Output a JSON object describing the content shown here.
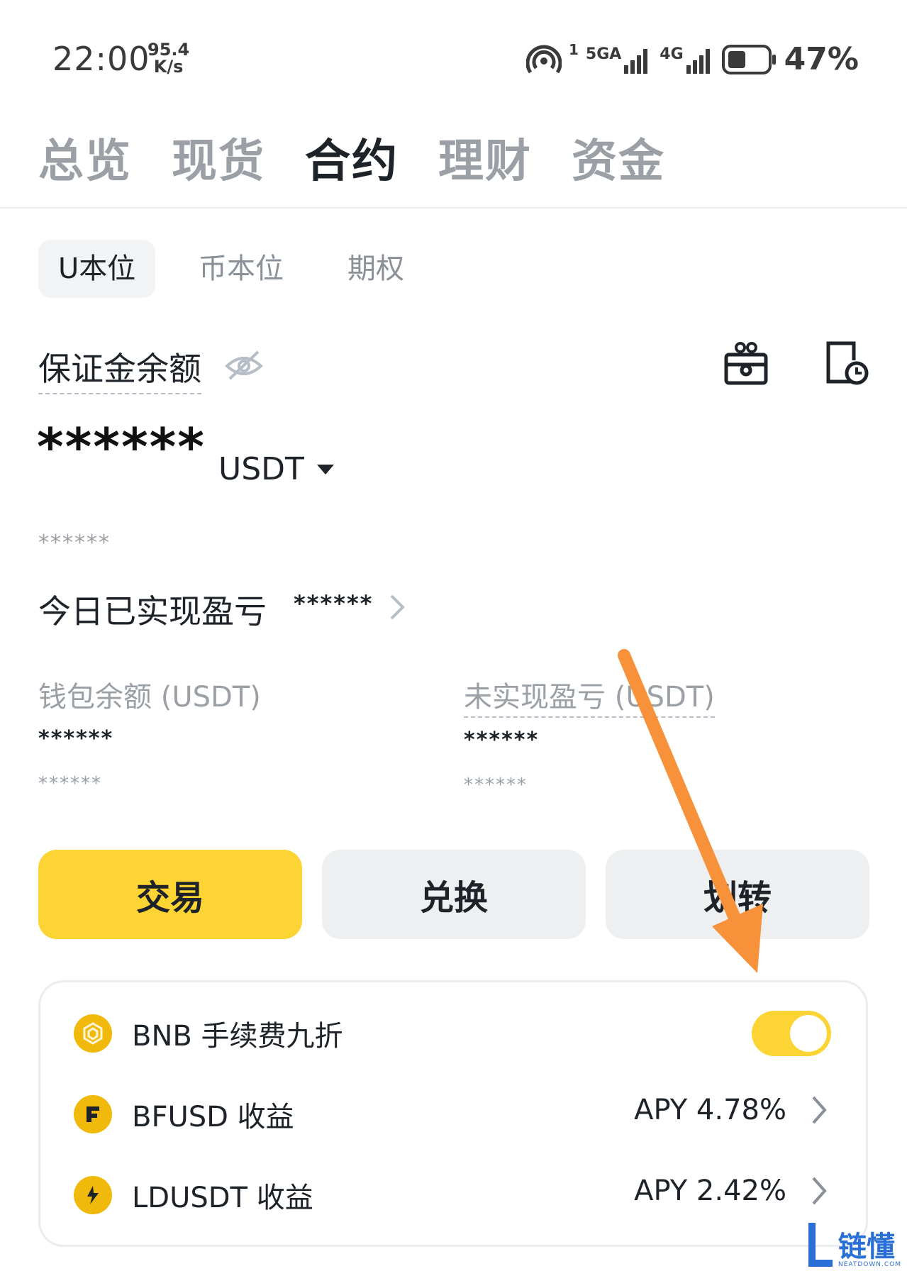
{
  "status_bar": {
    "time": "22:00",
    "speed_value": "95.4",
    "speed_unit": "K/s",
    "sim1_label": "1",
    "net1_label": "5GA",
    "net2_label": "4G",
    "battery_percent": "47%",
    "battery_level": 0.47
  },
  "top_tabs": [
    "总览",
    "现货",
    "合约",
    "理财",
    "资金"
  ],
  "top_tab_active": "合约",
  "sub_tabs": [
    "U本位",
    "币本位",
    "期权"
  ],
  "sub_tab_active": "U本位",
  "balance": {
    "label": "保证金余额",
    "amount": "******",
    "currency": "USDT",
    "equiv": "******"
  },
  "pnl": {
    "label": "今日已实现盈亏",
    "value": "******"
  },
  "wallet": {
    "label": "钱包余额 (USDT)",
    "value": "******",
    "sub": "******"
  },
  "unrealized": {
    "label": "未实现盈亏 (USDT)",
    "value": "******",
    "sub": "******"
  },
  "buttons": {
    "trade": "交易",
    "convert": "兑换",
    "transfer": "划转"
  },
  "features": [
    {
      "label": "BNB 手续费九折",
      "toggle_on": true
    },
    {
      "label": "BFUSD 收益",
      "apy": "APY 4.78%"
    },
    {
      "label": "LDUSDT 收益",
      "apy": "APY 2.42%"
    }
  ],
  "watermark": {
    "text": "链懂",
    "sub": "NEATDOWN.COM",
    "letter": "L"
  },
  "colors": {
    "accent": "#fcd535",
    "bnb": "#f0b90b",
    "annotation_arrow": "#f7913a",
    "watermark": "#2a6fd6"
  }
}
